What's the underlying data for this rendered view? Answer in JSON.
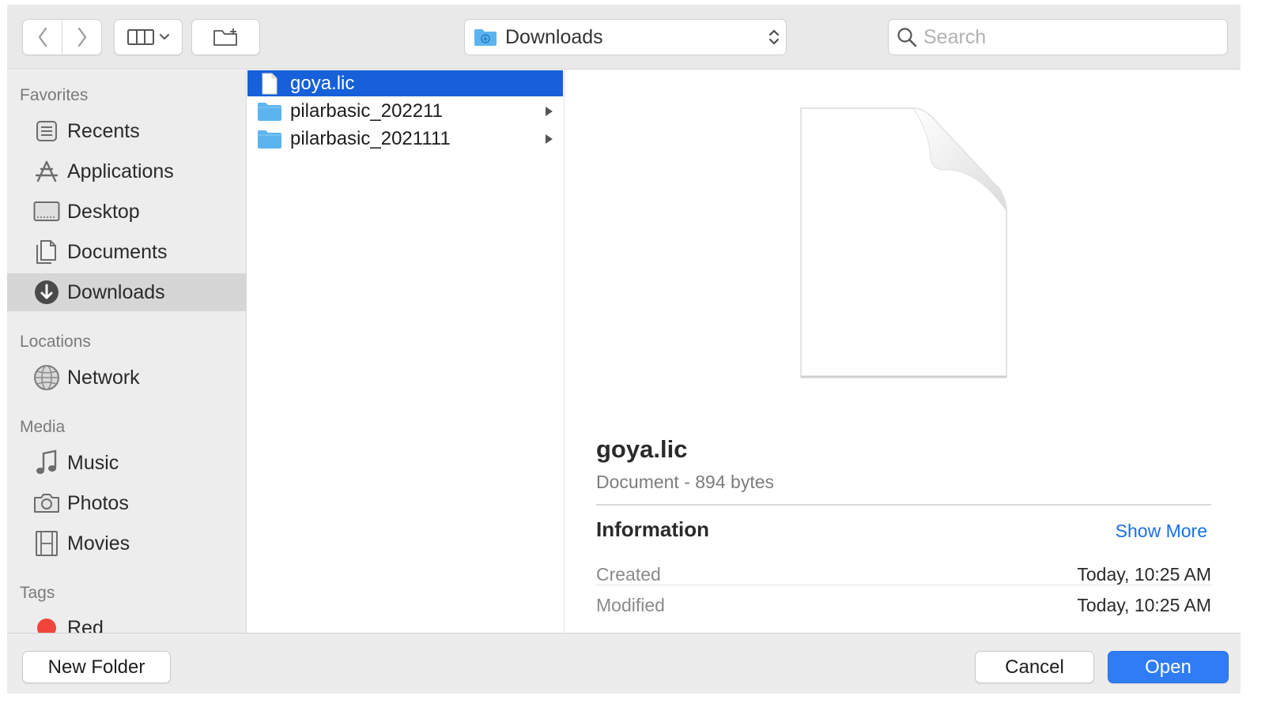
{
  "toolbar": {
    "location_label": "Downloads",
    "search_placeholder": "Search"
  },
  "sidebar": {
    "sections": [
      {
        "title": "Favorites"
      },
      {
        "title": "Locations"
      },
      {
        "title": "Media"
      },
      {
        "title": "Tags"
      }
    ],
    "favorites": [
      {
        "label": "Recents",
        "icon": "recents-icon"
      },
      {
        "label": "Applications",
        "icon": "applications-icon"
      },
      {
        "label": "Desktop",
        "icon": "desktop-icon"
      },
      {
        "label": "Documents",
        "icon": "documents-icon"
      },
      {
        "label": "Downloads",
        "icon": "downloads-icon",
        "selected": true
      }
    ],
    "locations": [
      {
        "label": "Network",
        "icon": "network-icon"
      }
    ],
    "media": [
      {
        "label": "Music",
        "icon": "music-icon"
      },
      {
        "label": "Photos",
        "icon": "photos-icon"
      },
      {
        "label": "Movies",
        "icon": "movies-icon"
      }
    ],
    "tags": [
      {
        "label": "Red",
        "color": "#f0453a"
      }
    ]
  },
  "files": [
    {
      "name": "goya.lic",
      "type": "document",
      "selected": true
    },
    {
      "name": "pilarbasic_202211",
      "type": "folder"
    },
    {
      "name": "pilarbasic_2021111",
      "type": "folder"
    }
  ],
  "preview": {
    "name": "goya.lic",
    "kind": "Document - 894 bytes",
    "info_heading": "Information",
    "show_more": "Show More",
    "details": [
      {
        "key": "Created",
        "value": "Today, 10:25 AM"
      },
      {
        "key": "Modified",
        "value": "Today, 10:25 AM"
      }
    ]
  },
  "buttons": {
    "new_folder": "New Folder",
    "cancel": "Cancel",
    "open": "Open"
  },
  "colors": {
    "accent": "#1660d9",
    "open_button": "#2f7cf6",
    "link": "#1a6fe6",
    "folder": "#5cb4ef"
  }
}
